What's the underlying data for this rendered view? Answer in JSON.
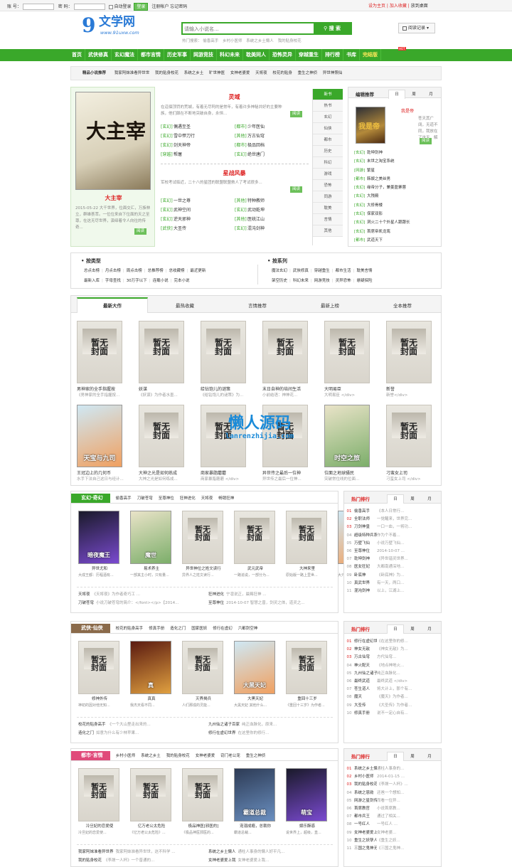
{
  "topbar": {
    "account_label": "账 号：",
    "password_label": "密 码：",
    "auto_login": "自动登录",
    "login_btn": "登录",
    "register": "注册帐户",
    "forgot": "忘记密码",
    "set_home": "设为主页",
    "add_fav": "加入收藏",
    "save_desktop": "放到桌面"
  },
  "logo": {
    "main": "文学网",
    "sub": "www.91uxw.com"
  },
  "search": {
    "placeholder": "请输入小说名...",
    "button": "搜 索",
    "hot_label": "热门搜索：",
    "hot": [
      "偷香高手",
      "乡村小医师",
      "系统之乡土懒人",
      "我的贴身校花"
    ]
  },
  "history_btn": "阅读记录",
  "nav": [
    "首页",
    "武侠修真",
    "玄幻魔法",
    "都市言情",
    "历史军事",
    "网游竞技",
    "科幻未来",
    "耽美同人",
    "恐怖灵异",
    "穿越重生",
    "排行榜",
    "书库",
    "完结版"
  ],
  "nav_hot_badge": "HOT",
  "subnav": [
    "精品小说推荐",
    "我家阿妹准看异世世",
    "我的贴身校花",
    "系统之乡土",
    "旷世神医",
    "女神老婆爱",
    "天将夜",
    "校花的贴身",
    "重生之神侦",
    "异世神照仙"
  ],
  "featured": {
    "title": "大主宰",
    "date": "2015-05-22",
    "desc": "大千世界，位面交汇，万族林立，群雄荟萃。一位位来自下位面的天之至尊，在这无尽世界，演绎着令人向往的传奇...",
    "read": "阅读"
  },
  "mid": {
    "b1_title": "灵域",
    "b1_desc": "在這個顶罚的荒城，有着无尽阿的是常年，有着许多神秘并好的主要种族，他们颇在不断地突破自身，永恒...",
    "b1_read": "阅读",
    "b1_rows": [
      [
        "[玄幻]",
        "偶遇至圣",
        "[都市]",
        "少年医仙"
      ],
      [
        "[玄幻]",
        "雪中悍刀行",
        "[其他]",
        "万古仙穹"
      ],
      [
        "[玄幻]",
        "剑天神帝",
        "[都市]",
        "极品回档"
      ],
      [
        "[穿越]",
        "帮屠",
        "[玄幻]",
        "绝世唐门"
      ]
    ],
    "b2_title": "星战风暴",
    "b2_desc": "军校考试临近，二十八的星团的联盟联盟救人了考试很多...",
    "b2_read": "阅读",
    "b2_rows": [
      [
        "[玄幻]",
        "一世之尊",
        "[其他]",
        "特种教师"
      ],
      [
        "[玄幻]",
        "武神空间",
        "[玄幻]",
        "武动乾坤"
      ],
      [
        "[玄幻]",
        "逆天邪神",
        "[其他]",
        "医统江山"
      ],
      [
        "[武侠]",
        "大圣传",
        "[玄幻]",
        "混沌剑神"
      ]
    ]
  },
  "cat_tabs": [
    "新书",
    "热书",
    "玄幻",
    "仙侠",
    "都市",
    "历史",
    "科幻",
    "游戏",
    "恐怖",
    "同游",
    "耽美",
    "言情",
    "其他"
  ],
  "editor": {
    "title": "编辑推荐",
    "tabs": [
      "日",
      "周",
      "月"
    ],
    "book": "我是帝",
    "book_desc": "苍天其广阔，无道不同，我放在了这天，解脱了说来之事，这就其个殿，一幕血...",
    "read": "阅读",
    "rows": [
      [
        "[玄幻]",
        "乾坤剑神"
      ],
      [
        "[玄幻]",
        "末世之淘宝系统"
      ],
      [
        "[网游]",
        "繁星"
      ],
      [
        "[都市]",
        "韩娱之美丝男"
      ],
      [
        "[玄幻]",
        "缘帝分子，兼姜盈寨蓉"
      ],
      [
        "[玄幻]",
        "大残殿"
      ],
      [
        "[玄幻]",
        "大修骨楼"
      ],
      [
        "[玄幻]",
        "保家双影"
      ],
      [
        "[玄幻]",
        "洞火二十个外星人跟跟长"
      ],
      [
        "[玄幻]",
        "首席帝凯龙鸾"
      ],
      [
        "[都市]",
        "武道天下"
      ]
    ]
  },
  "types": {
    "t1": "按类型",
    "r1a": [
      "总点击榜",
      "月点击榜",
      "周点击榜",
      "总推荐榜",
      "总收藏榜",
      "最近更新"
    ],
    "r1b": [
      "最新入库",
      "字母查找",
      "30万字以下",
      "连载小说",
      "完本小说"
    ],
    "t2": "按系列",
    "r2a": [
      "魔法玄幻",
      "武侠修真",
      "穿越重生",
      "都市生活",
      "耽美言情"
    ],
    "r2b": [
      "架空历史",
      "科幻未来",
      "网游竞技",
      "灵异恐怖",
      "悬疑探险"
    ]
  },
  "watermark": {
    "main": "懒人源码",
    "sub": "lanrenzhijia.com"
  },
  "main_tabs": [
    "最新大作",
    "最热收藏",
    "言情推荐",
    "最新上榜",
    "全本推荐"
  ],
  "grid": [
    {
      "cover": "暂无封面",
      "name": "男神家的全手指握按",
      "desc": "《男神家的全手指握按..."
    },
    {
      "cover": "暂无封面",
      "name": "妖谋",
      "desc": "《妖谋》为作者水墨..."
    },
    {
      "cover": "暂无封面",
      "name": "给钻饱儿的谜策",
      "desc": "《给钻饱儿的谜策》为..."
    },
    {
      "cover": "暂无封面",
      "name": "末日自神的培间生活",
      "desc": "小前结语：神神花..."
    },
    {
      "cover": "暂无封面",
      "name": "大明易臣",
      "desc": "大明易臣 </div>"
    },
    {
      "cover": "暂无封面",
      "name": "新誉",
      "desc": "新誉</div>"
    },
    {
      "cover": "天宝与九司",
      "name": "王冠边上的几何币",
      "desc": "水手下法自己这日与经计..."
    },
    {
      "cover": "暂无封面",
      "name": "大神之光是如何练成",
      "desc": "大神之光是如何练成..."
    },
    {
      "cover": "暂无封面",
      "name": "商家暴脂蘑蘑",
      "desc": "商家暴脂蘑蘑 </div>"
    },
    {
      "cover": "暂无封面",
      "name": "异世传之最后一位神",
      "desc": "异世传之最后一位神..."
    },
    {
      "cover": "时空之旅",
      "name": "位面之地球骚民",
      "desc": "突破常住线的位面..."
    },
    {
      "cover": "暂无封面",
      "name": "刁蛮女上司",
      "desc": "刁蛮女上司 </div>"
    }
  ],
  "sections": [
    {
      "title": "玄幻·奇幻",
      "color": "#3aa82a",
      "links": [
        "偷香高手",
        "刀破苍穹",
        "至尊神位",
        "狂神进化",
        "天将夜",
        "畅销狂神"
      ],
      "books": [
        {
          "cover": "暗夜魔王",
          "name": "异世尤和",
          "desc": "大成王都：历程酒有..."
        },
        {
          "cover": "魔世",
          "name": "易术养主",
          "desc": "一部其主小时，只有量..."
        },
        {
          "cover": "暂无封面",
          "name": "异世神位之姓文读行",
          "desc": "异界人之姓文读行..."
        },
        {
          "cover": "暂无封面",
          "name": "武元武帝",
          "desc": "一路追说，一部分为..."
        },
        {
          "cover": "暂无封面",
          "name": "大神来里",
          "desc": "原始版一路上里世..."
        },
        {
          "cover": "大主宰",
          "name": "原始版帝国大宗匈",
          "desc": "大元明帝国之宗..."
        }
      ],
      "notes": [
        [
          "天将夜",
          "《天将夜》为作者奇巧工 ..."
        ],
        [
          "狂神进化",
          "宁凛说正，晨赐狂神 ..."
        ],
        [
          "刀破苍穹",
          "小说刀破苍穹的简介：</font></p>【2014..."
        ],
        [
          "至尊神位",
          "2014-10-07 智慧之曾，剑灵之体，道灵之..."
        ]
      ],
      "rank_title": "热门排行",
      "rank_tabs": [
        "日",
        "周",
        "月"
      ],
      "rank": [
        [
          "01",
          "偷香高手",
          "《本人日常行..."
        ],
        [
          "02",
          "全职法师",
          "一觉醒来，世界完..."
        ],
        [
          "03",
          "刀剑神皇",
          "一口一血，一将功..."
        ],
        [
          "04",
          "超级特种兵系统",
          "作为个不着..."
        ],
        [
          "05",
          "万壁飞仙",
          "小说万壁飞仙..."
        ],
        [
          "06",
          "至尊神位",
          "2014-10-07 ..."
        ],
        [
          "07",
          "乾坤剑神",
          "《异世谐灵世界..."
        ],
        [
          "08",
          "医女狂妃",
          "大都南通深地..."
        ],
        [
          "09",
          "卧底神",
          "《卧底神》为..."
        ],
        [
          "10",
          "真武世界",
          "有一天，两口..."
        ],
        [
          "11",
          "混沌剑神",
          "以上，江湖上..."
        ]
      ]
    },
    {
      "title": "武侠·仙侠",
      "color": "#8a6a4a",
      "links": [
        "校花的贴身高手",
        "修真手册",
        "造化之门",
        "国家医妖",
        "修行在虚幻",
        "六都剑空神"
      ],
      "books": [
        {
          "cover": "暂无封面",
          "name": "修神外传",
          "desc": "神初的因对他无知..."
        },
        {
          "cover": "真",
          "name": "真真",
          "desc": "我杰天看不同..."
        },
        {
          "cover": "暂无封面",
          "name": "灭界揭兵",
          "desc": "人们那成的灵能..."
        },
        {
          "cover": "大黑天妃",
          "name": "大黑天妃",
          "desc": "大黑天妃 其他什么..."
        },
        {
          "cover": "暂无封面",
          "name": "重回十三岁",
          "desc": "《重回十三岁》为作者..."
        }
      ],
      "notes": [
        [
          "校花的贴身高手",
          "《一个大山里走出来的..."
        ],
        [
          "九州仙之诸子百家",
          "纯正血脉化，原来..."
        ],
        [
          "造化之门",
          "如意为什么有少林苹果..."
        ],
        [
          "修行在虚幻世界",
          "在这里你的修行..."
        ]
      ],
      "rank_title": "热门排行",
      "rank_tabs": [
        "日",
        "周",
        "月"
      ],
      "rank": [
        [
          "01",
          "修行在虚幻世界",
          "《在这里你的修..."
        ],
        [
          "02",
          "神女无敌",
          "《神女无敌》为..."
        ],
        [
          "03",
          "万古仙穹",
          "方代仙穹..."
        ],
        [
          "04",
          "神火配天",
          "《地点神地火..."
        ],
        [
          "05",
          "九州仙之诸子百家",
          "纯正血脉化..."
        ],
        [
          "06",
          "最终武道",
          "最终武道 </div>"
        ],
        [
          "07",
          "苍生道人",
          "将大计上，那个有..."
        ],
        [
          "08",
          "魔天",
          "《魔天》为作者..."
        ],
        [
          "09",
          "大圣传",
          "《大圣传》为作者..."
        ],
        [
          "10",
          "修真手册",
          "说不一定心自有..."
        ]
      ]
    },
    {
      "title": "都市·言情",
      "color": "#e04a7a",
      "links": [
        "乡村小医师",
        "系统之乡土",
        "我的贴身校花",
        "女神老婆爱",
        "窃门老公宠",
        "重生之神侦"
      ],
      "books": [
        {
          "cover": "暂无封面",
          "name": "冷旦妃的恋爱使",
          "desc": "冷旦妃的恋爱使..."
        },
        {
          "cover": "暂无封面",
          "name": "亿万老公太危险",
          "desc": "《亿万老公太危险》..."
        },
        {
          "cover": "暂无封面",
          "name": "极品神医[邪医的]",
          "desc": "《极品神医邪医的..."
        },
        {
          "cover": "霸道总裁",
          "name": "宠溺成瘾，总裁你",
          "desc": "霸道总裁..."
        },
        {
          "cover": "萌宝",
          "name": "娱乐酥惑",
          "desc": "说世界上，超级，直..."
        }
      ],
      "notes": [
        [
          "我家阿妹准看异世界",
          "我家阿妹准看异世世，这不科学 ..."
        ],
        [
          "系统之乡土懒人",
          "通柱人事身的懒人好平凡..."
        ],
        [
          "我的贴身校花",
          "《李晟一人杯》一个普通的..."
        ],
        [
          "女神老婆爱上我",
          "女神老婆爱上我..."
        ]
      ],
      "rank_title": "热门排行",
      "rank_tabs": [
        "日",
        "周",
        "月"
      ],
      "rank": [
        [
          "01",
          "系统之乡土懒人",
          "通柱人事身的..."
        ],
        [
          "02",
          "乡村小医师",
          "2014-01-15 ..."
        ],
        [
          "03",
          "我的贴身校花",
          "《李晟一人杯》..."
        ],
        [
          "04",
          "系统之恩勋",
          "还爸一个想知..."
        ],
        [
          "05",
          "网游之星剑传奇",
          "而看一位异..."
        ],
        [
          "06",
          "首席教官",
          "小说首席教..."
        ],
        [
          "07",
          "都市兵王",
          "通过了相关..."
        ],
        [
          "08",
          "一号红人",
          "一号红人 ..."
        ],
        [
          "09",
          "女神老婆爱上我",
          "女神老婆..."
        ],
        [
          "10",
          "重生之妖孽人生",
          "《重生之妖..."
        ],
        [
          "11",
          "三国之鬼神无双",
          "《三国之鬼神..."
        ]
      ]
    }
  ]
}
